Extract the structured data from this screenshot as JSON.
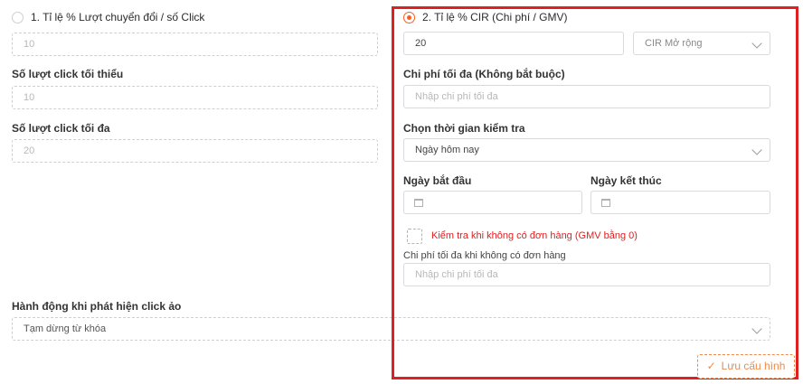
{
  "left": {
    "option1": {
      "label": "1. Tỉ lệ % Lượt chuyển đổi / số Click",
      "value": "10"
    },
    "min_clicks": {
      "label": "Số lượt click tối thiểu",
      "value": "10"
    },
    "max_clicks": {
      "label": "Số lượt click tối đa",
      "value": "20"
    },
    "action": {
      "label": "Hành động khi phát hiện click ảo",
      "selected": "Tạm dừng từ khóa"
    }
  },
  "right": {
    "option2": {
      "label": "2. Tỉ lệ % CIR (Chi phí / GMV)",
      "value": "20",
      "mode_selected": "CIR Mở rộng"
    },
    "max_cost": {
      "label": "Chi phí tối đa (Không bắt buộc)",
      "placeholder": "Nhập chi phí tối đa"
    },
    "check_time": {
      "label": "Chọn thời gian kiểm tra",
      "selected": "Ngày hôm nay"
    },
    "start_date": {
      "label": "Ngày bắt đầu"
    },
    "end_date": {
      "label": "Ngày kết thúc"
    },
    "no_order_check": {
      "label": "Kiểm tra khi không có đơn hàng (GMV bằng 0)"
    },
    "max_cost_no_order": {
      "label": "Chi phí tối đa khi không có đơn hàng",
      "placeholder": "Nhập chi phí tối đa"
    }
  },
  "save_button": {
    "label": "Lưu cấu hình"
  },
  "icons": [
    "radio-icon",
    "calendar-icon",
    "chevron-down-icon",
    "check-icon"
  ],
  "colors": {
    "accent": "#ff5a1f",
    "highlight_border": "#e02020",
    "warning_text": "#e02020",
    "save_button": "#f08a4b"
  }
}
